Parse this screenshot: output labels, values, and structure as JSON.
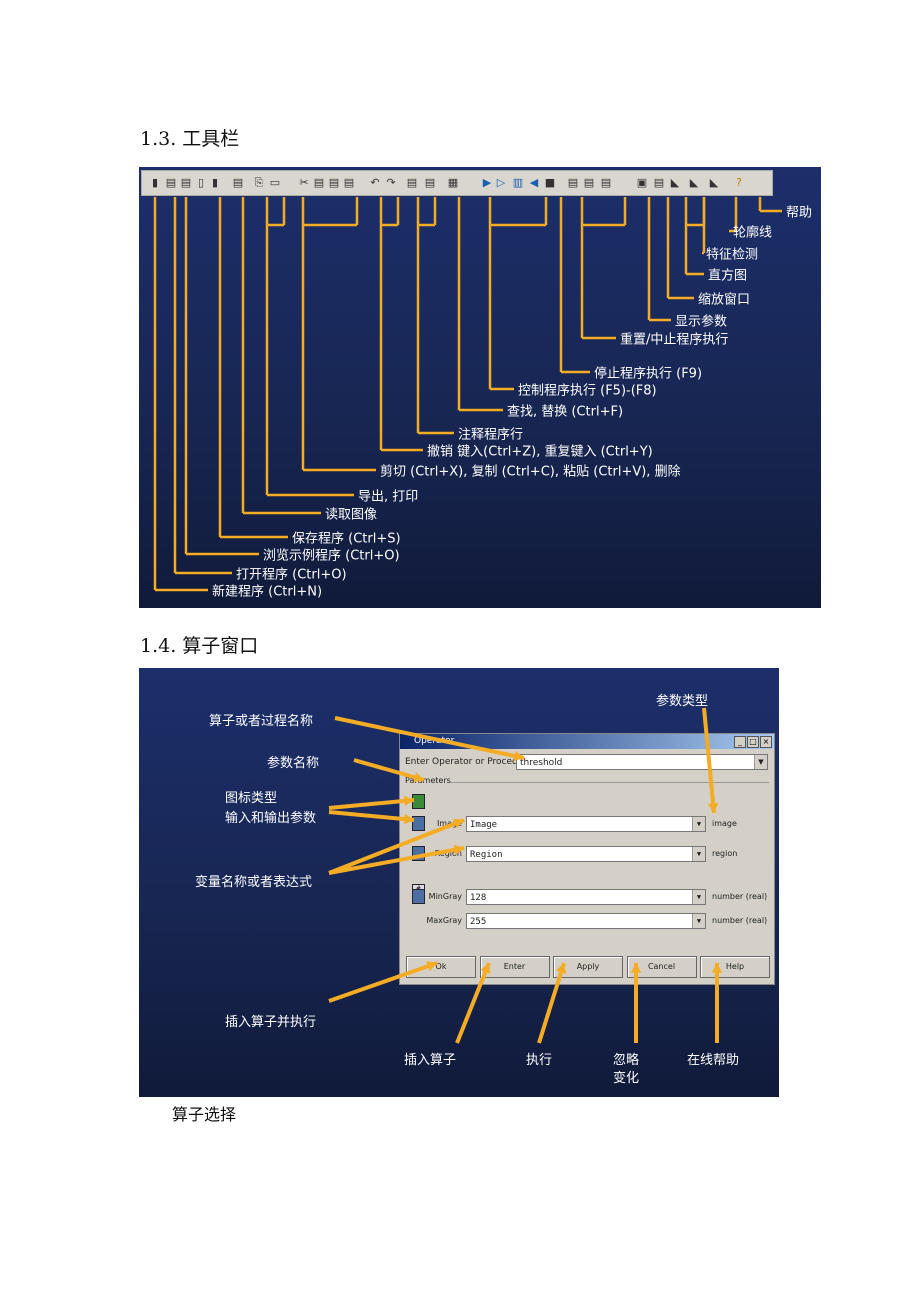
{
  "section1": {
    "heading": "1.3. 工具栏",
    "toolbar_icons": [
      "new-icon",
      "open-icon",
      "browse-icon",
      "save-icon",
      "save-as-icon",
      "read-image-icon",
      "export-icon",
      "print-icon",
      "cut-icon",
      "copy-icon",
      "paste-icon",
      "delete-icon",
      "undo-icon",
      "redo-icon",
      "comment-icon",
      "uncomment-icon",
      "find-icon",
      "run-icon",
      "step-icon",
      "step-into-icon",
      "step-out-icon",
      "stop-icon",
      "reset-icon",
      "abort-icon",
      "reset-all-icon",
      "display-params-icon",
      "zoom-window-icon",
      "histogram-icon",
      "feature-icon",
      "contour-icon",
      "help-icon"
    ],
    "labels": [
      "帮助",
      "轮廓线",
      "特征检测",
      "直方图",
      "缩放窗口",
      "显示参数",
      "重置/中止程序执行",
      "停止程序执行 (F9)",
      "控制程序执行 (F5)-(F8)",
      "查找, 替换 (Ctrl+F)",
      "注释程序行",
      "撤销 键入(Ctrl+Z), 重复键入 (Ctrl+Y)",
      "剪切 (Ctrl+X), 复制 (Ctrl+C), 粘贴 (Ctrl+V), 删除",
      "导出, 打印",
      "读取图像",
      "保存程序 (Ctrl+S)",
      "浏览示例程序 (Ctrl+O)",
      "打开程序 (Ctrl+O)",
      "新建程序 (Ctrl+N)"
    ],
    "accent": "#f5ac25"
  },
  "section2": {
    "heading": "1.4. 算子窗口",
    "dialog": {
      "title": "Operator",
      "op_label": "Enter Operator or Procedure",
      "op_value": "threshold",
      "params_label": "Parameters",
      "params": [
        {
          "name": "Image",
          "value": "Image",
          "type": "image"
        },
        {
          "name": "Region",
          "value": "Region",
          "type": "region"
        },
        {
          "name": "MinGray",
          "value": "128",
          "type": "number (real)"
        },
        {
          "name": "MaxGray",
          "value": "255",
          "type": "number (real)"
        }
      ],
      "buttons": [
        "Ok",
        "Enter",
        "Apply",
        "Cancel",
        "Help"
      ]
    },
    "annotations": {
      "op_name": "算子或者过程名称",
      "param_type": "参数类型",
      "param_name": "参数名称",
      "icon_type": "图标类型",
      "io_params": "输入和输出参数",
      "var_name": "变量名称或者表达式",
      "insert_run": "插入算子并执行",
      "insert": "插入算子",
      "execute": "执行",
      "ignore1": "忽略",
      "ignore2": "变化",
      "online_help": "在线帮助"
    }
  },
  "caption": "算子选择"
}
